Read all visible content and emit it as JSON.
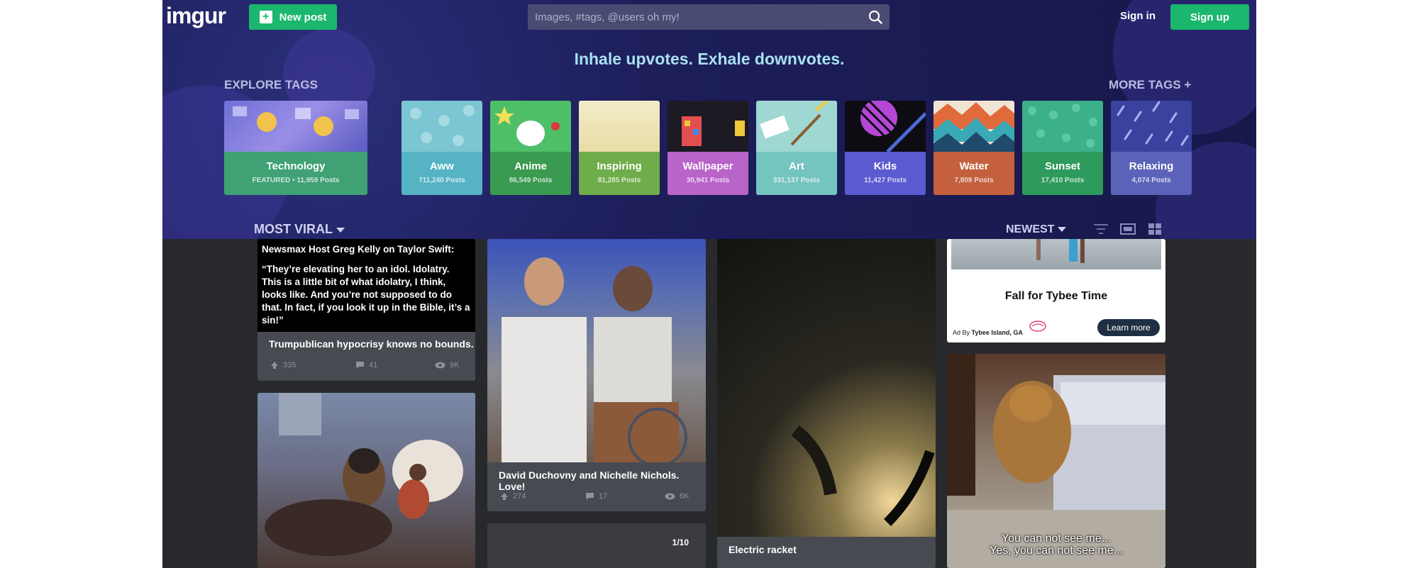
{
  "header": {
    "logo": "imgur",
    "new_post_label": "New post",
    "search_placeholder": "Images, #tags, @users oh my!",
    "signin_label": "Sign in",
    "signup_label": "Sign up",
    "tagline": "Inhale upvotes. Exhale downvotes.",
    "accent_color": "#1bb76e"
  },
  "tags": {
    "title": "EXPLORE TAGS",
    "more_label": "MORE TAGS +",
    "items": [
      {
        "name": "Technology",
        "count": "FEATURED • 11,959 Posts",
        "color": "#3fa174"
      },
      {
        "name": "Aww",
        "count": "711,240 Posts",
        "color": "#55b3c4"
      },
      {
        "name": "Anime",
        "count": "86,549 Posts",
        "color": "#3a9a4f"
      },
      {
        "name": "Inspiring",
        "count": "81,285 Posts",
        "color": "#6fac4a"
      },
      {
        "name": "Wallpaper",
        "count": "30,941 Posts",
        "color": "#b864c9"
      },
      {
        "name": "Art",
        "count": "331,137 Posts",
        "color": "#74c4bf"
      },
      {
        "name": "Kids",
        "count": "11,427 Posts",
        "color": "#5b5ad0"
      },
      {
        "name": "Water",
        "count": "7,809 Posts",
        "color": "#c4603e"
      },
      {
        "name": "Sunset",
        "count": "17,410 Posts",
        "color": "#2e9a5c"
      },
      {
        "name": "Relaxing",
        "count": "4,074 Posts",
        "color": "#5b63b8"
      }
    ]
  },
  "sort": {
    "left": "MOST VIRAL",
    "right": "NEWEST"
  },
  "posts": {
    "quote_heading": "Newsmax Host Greg Kelly on Taylor Swift:",
    "quote_body": "“They’re elevating her to an idol. Idolatry. This is a little bit of what idolatry, I think, looks like. And you’re not supposed to do that. In fact, if you look it up in the Bible, it’s a sin!”",
    "post1": {
      "title": "Trumpublican hypocrisy knows no bounds.",
      "ups": "335",
      "comments": "41",
      "views": "9K"
    },
    "post2": {
      "title": "David Duchovny and Nichelle Nichols. Love!",
      "ups": "274",
      "comments": "17",
      "views": "6K"
    },
    "post3": {
      "title": "Electric racket"
    },
    "post4": {
      "counter": "1/10"
    },
    "post5": {
      "caption_line1": "You can not see me...",
      "caption_line2": "Yes, you can not see me..."
    }
  },
  "ad": {
    "title": "Fall for Tybee Time",
    "ad_by_prefix": "Ad By",
    "ad_by": "Tybee Island, GA",
    "cta": "Learn more"
  }
}
